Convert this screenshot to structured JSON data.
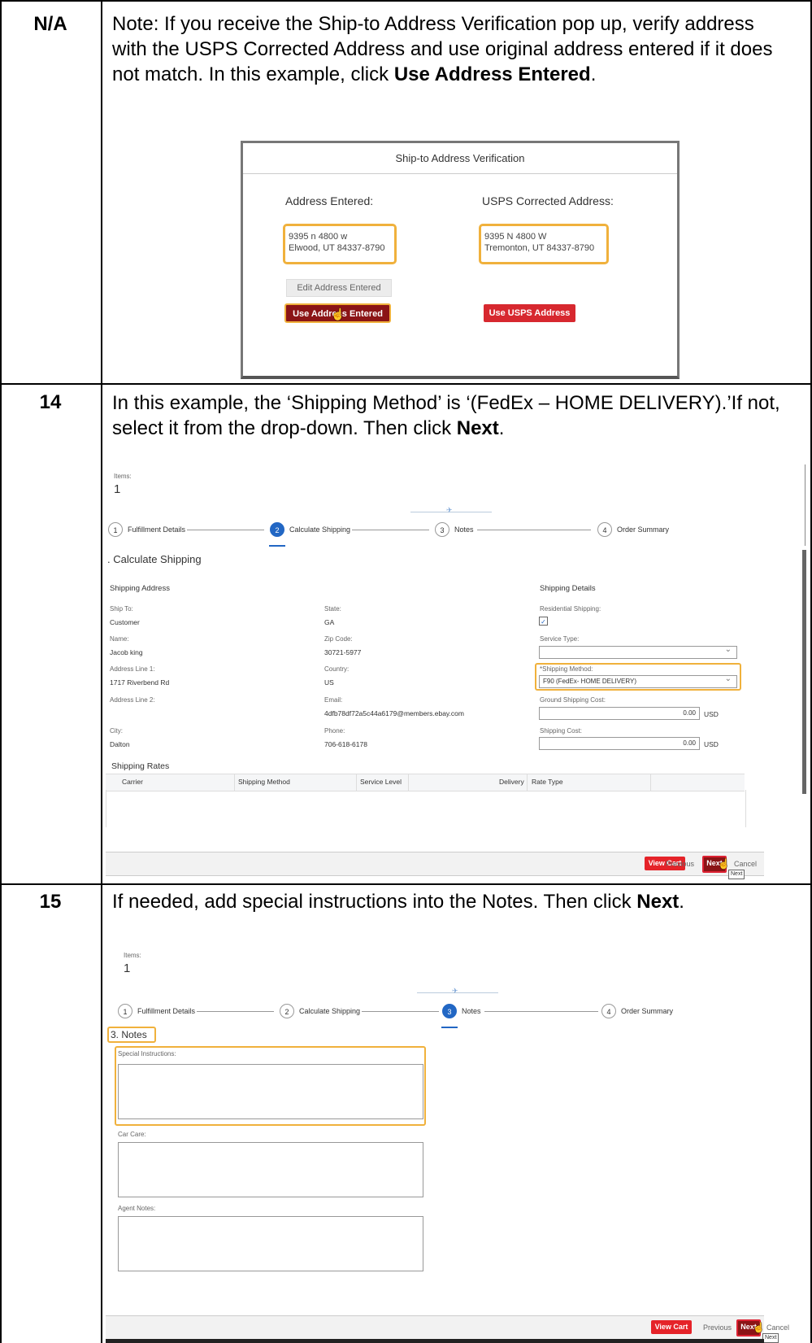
{
  "rows": [
    {
      "step": "N/A",
      "text_a": "Note: If you receive the Ship-to Address Verification pop up, verify address with the USPS Corrected Address and use original address entered if it does not match. In this example, click ",
      "text_bold": "Use Address Entered",
      "text_b": "."
    },
    {
      "step": "14",
      "text_a": "In this example, the ‘Shipping Method’ is ‘(FedEx – HOME DELIVERY).’If not, select it from the drop-down. Then click ",
      "text_bold": "Next",
      "text_b": "."
    },
    {
      "step": "15",
      "text_a": "If needed, add special instructions into the Notes. Then click ",
      "text_bold": "Next",
      "text_b": "."
    }
  ],
  "popup": {
    "title": "Ship-to Address Verification",
    "entered_label": "Address Entered:",
    "usps_label": "USPS Corrected Address:",
    "entered_line1": "9395 n 4800 w",
    "entered_line2": "Elwood, UT 84337-8790",
    "usps_line1": "9395 N 4800 W",
    "usps_line2": "Tremonton, UT 84337-8790",
    "edit_button": "Edit Address Entered",
    "use_entered_button": "Use Address Entered",
    "use_usps_button": "Use USPS Address"
  },
  "shipping_screen": {
    "items_label": "Items:",
    "items_count": "1",
    "steps": [
      {
        "num": "1",
        "label": "Fulfillment Details"
      },
      {
        "num": "2",
        "label": "Calculate Shipping"
      },
      {
        "num": "3",
        "label": "Notes"
      },
      {
        "num": "4",
        "label": "Order Summary"
      }
    ],
    "section_title": ". Calculate Shipping",
    "shipping_address_title": "Shipping Address",
    "shipping_details_title": "Shipping Details",
    "ship_to_label": "Ship To:",
    "ship_to": "Customer",
    "state_label": "State:",
    "state": "GA",
    "name_label": "Name:",
    "name": "Jacob king",
    "zip_label": "Zip Code:",
    "zip": "30721-5977",
    "addr1_label": "Address Line 1:",
    "addr1": "1717 Riverbend Rd",
    "country_label": "Country:",
    "country": "US",
    "addr2_label": "Address Line 2:",
    "email_label": "Email:",
    "email": "4dfb78df72a5c44a6179@members.ebay.com",
    "city_label": "City:",
    "city": "Dalton",
    "phone_label": "Phone:",
    "phone": "706-618-6178",
    "residential_label": "Residential Shipping:",
    "residential_checked": "✓",
    "service_type_label": "Service Type:",
    "service_type": "",
    "shipping_method_label": "*Shipping Method:",
    "shipping_method": "F90 (FedEx- HOME DELIVERY)",
    "ground_cost_label": "Ground Shipping Cost:",
    "ground_cost": "0.00",
    "shipping_cost_label": "Shipping Cost:",
    "shipping_cost": "0.00",
    "currency": "USD",
    "rates_title": "Shipping Rates",
    "rate_columns": [
      "Carrier",
      "Shipping Method",
      "Service Level",
      "Delivery",
      "Rate Type"
    ]
  },
  "notes_screen": {
    "items_label": "Items:",
    "items_count": "1",
    "section_title": "3. Notes",
    "special_label": "Special Instructions:",
    "car_care_label": "Car Care:",
    "agent_notes_label": "Agent Notes:"
  },
  "footer": {
    "view_cart": "View Cart",
    "previous": "Previous",
    "next": "Next",
    "cancel": "Cancel",
    "tooltip": "Next"
  },
  "icons": {
    "chevron": "⌄",
    "pin": "✈",
    "cursor": "☝"
  }
}
